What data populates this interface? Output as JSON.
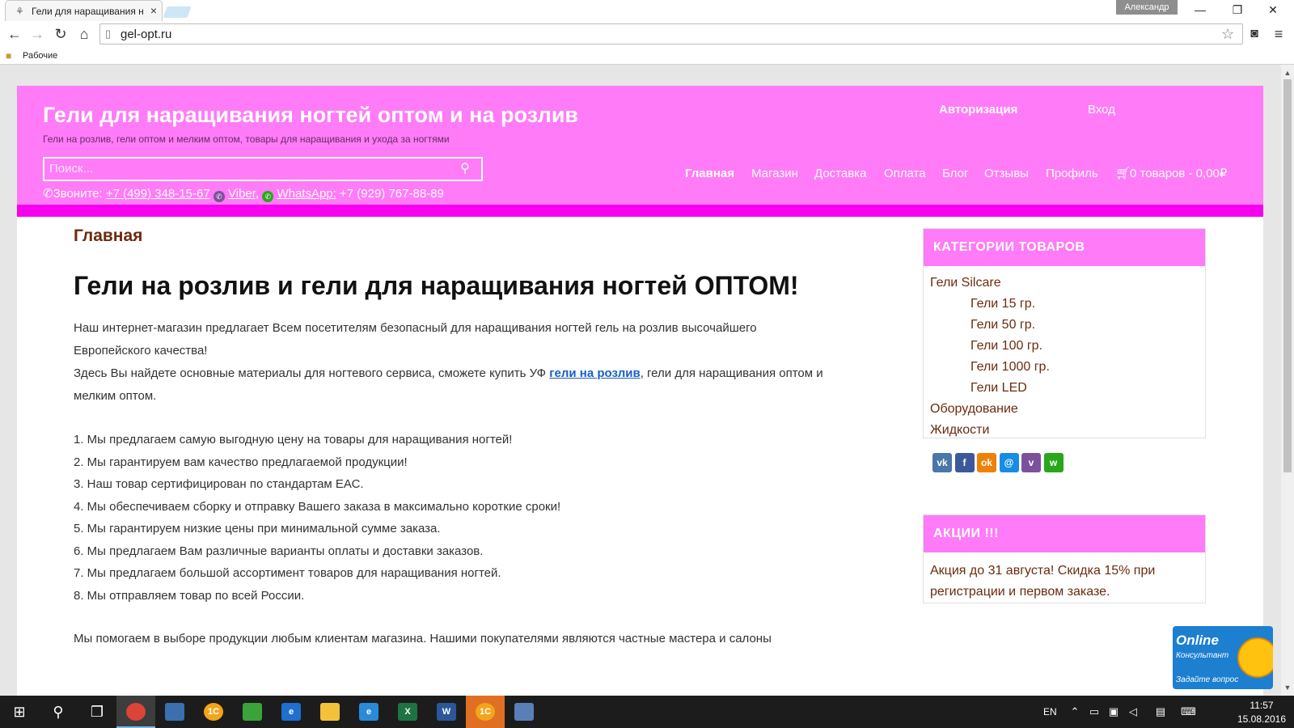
{
  "browser": {
    "tab_title": "Гели для наращивания н",
    "tab_close": "×",
    "user_name": "Александр",
    "url": "gel-opt.ru",
    "bookmark_folder": "Рабочие"
  },
  "header": {
    "title": "Гели для наращивания ногтей оптом и на розлив",
    "tagline": "Гели на розлив, гели оптом и мелким оптом, товары для наращивания и ухода за ногтями",
    "auth_label": "Авторизация",
    "login_label": "Вход",
    "search_placeholder": "Поиск...",
    "contact": {
      "call_label": "Звоните:",
      "phone": "+7 (499) 348-15-67",
      "viber_label": "Viber,",
      "whatsapp_label": "WhatsApp:",
      "whatsapp_phone": "+7 (929) 767-88-89"
    },
    "nav": [
      "Главная",
      "Магазин",
      "Доставка",
      "Оплата",
      "Блог",
      "Отзывы",
      "Профиль"
    ],
    "cart_label": "0 товаров - 0,00₽"
  },
  "main": {
    "breadcrumb": "Главная",
    "heading": "Гели на розлив и гели для наращивания ногтей ОПТОМ!",
    "intro_p1": "Наш интернет-магазин предлагает Всем посетителям безопасный для наращивания ногтей гель на розлив высочайшего Европейского качества!",
    "intro_p2_before": "Здесь Вы найдете основные материалы для ногтевого сервиса, сможете  купить УФ ",
    "intro_p2_link": "гели на розлив",
    "intro_p2_after": ", гели для наращивания оптом и мелким оптом.",
    "benefits": [
      "1. Мы предлагаем самую выгодную цену на товары для наращивания ногтей!",
      "2. Мы гарантируем вам качество предлагаемой продукции!",
      "3. Наш товар сертифицирован по стандартам ЕАС.",
      "4. Мы обеспечиваем сборку и отправку Вашего заказа в максимально короткие сроки!",
      "5. Мы гарантируем низкие цены при минимальной сумме заказа.",
      "6. Мы предлагаем Вам различные варианты оплаты и доставки заказов.",
      "7. Мы предлагаем большой ассортимент товаров для наращивания ногтей.",
      "8. Мы отправляем товар по всей России."
    ],
    "outro": "Мы помогаем в выборе продукции любым клиентам магазина. Нашими покупателями являются частные мастера и салоны"
  },
  "sidebar": {
    "categories_title": "КАТЕГОРИИ ТОВАРОВ",
    "categories": [
      {
        "label": "Гели Silcare",
        "sub": false
      },
      {
        "label": "Гели 15 гр.",
        "sub": true
      },
      {
        "label": "Гели 50 гр.",
        "sub": true
      },
      {
        "label": "Гели 100 гр.",
        "sub": true
      },
      {
        "label": "Гели 1000 гр.",
        "sub": true
      },
      {
        "label": "Гели LED",
        "sub": true
      },
      {
        "label": "Оборудование",
        "sub": false
      },
      {
        "label": "Жидкости",
        "sub": false
      }
    ],
    "social": [
      {
        "name": "vk-icon",
        "glyph": "vk",
        "color": "#4a76a8"
      },
      {
        "name": "facebook-icon",
        "glyph": "f",
        "color": "#3b5998"
      },
      {
        "name": "odnoklassniki-icon",
        "glyph": "ok",
        "color": "#ee8208"
      },
      {
        "name": "mailru-icon",
        "glyph": "@",
        "color": "#168de2"
      },
      {
        "name": "viber-icon",
        "glyph": "v",
        "color": "#7b519d"
      },
      {
        "name": "whatsapp-icon",
        "glyph": "w",
        "color": "#29a71a"
      }
    ],
    "sale_title": "АКЦИИ !!!",
    "sale_text": "Акция до 31 августа! Скидка 15% при регистрации и первом заказе."
  },
  "consultant": {
    "title": "Online",
    "subtitle": "Консультант",
    "ask": "Задайте вопрос"
  },
  "taskbar": {
    "lang": "EN",
    "time": "11:57",
    "date": "15.08.2016"
  },
  "colors": {
    "header_pink": "#ff7bf7",
    "header_bar": "#f700f0",
    "text_brown": "#6b2b0e",
    "link_blue": "#1a5fc4"
  }
}
